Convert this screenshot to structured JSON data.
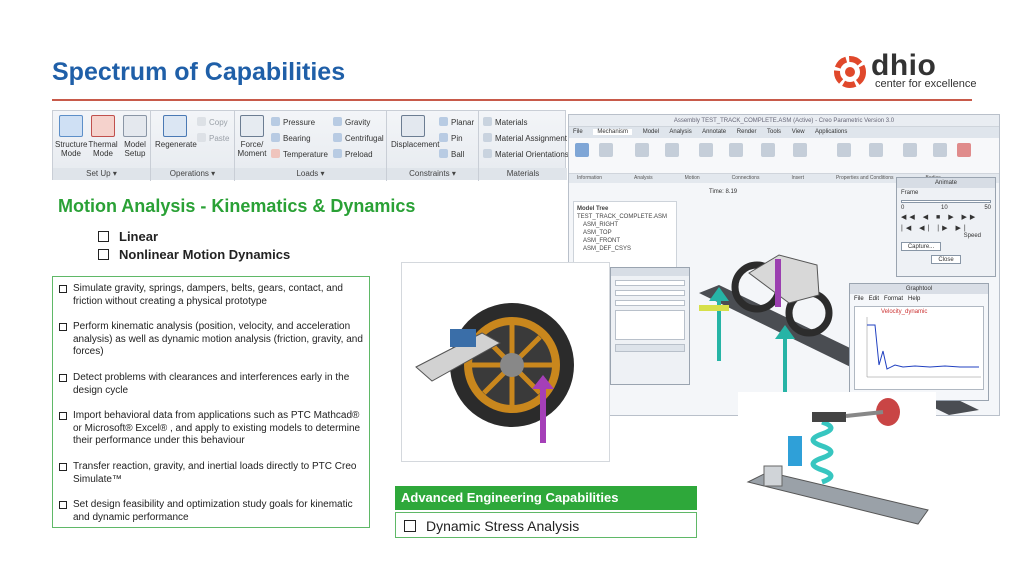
{
  "page": {
    "title": "Spectrum of Capabilities"
  },
  "logo": {
    "name": "dhio",
    "tagline": "center for excellence"
  },
  "ribbon": {
    "setup": {
      "label": "Set Up",
      "items": [
        "Structure Mode",
        "Thermal Mode",
        "Model Setup"
      ]
    },
    "operations": {
      "label": "Operations",
      "regenerate": "Regenerate",
      "copy": "Copy",
      "paste": "Paste"
    },
    "loads": {
      "label": "Loads",
      "force_moment": "Force/ Moment",
      "pressure": "Pressure",
      "bearing": "Bearing",
      "temperature": "Temperature",
      "gravity": "Gravity",
      "centrifugal": "Centrifugal",
      "preload": "Preload"
    },
    "constraints": {
      "label": "Constraints",
      "displacement": "Displacement",
      "planar": "Planar",
      "pin": "Pin",
      "ball": "Ball"
    },
    "materials": {
      "label": "Materials",
      "materials": "Materials",
      "assignment": "Material Assignment",
      "orientations": "Material Orientations"
    }
  },
  "cad_window": {
    "title": "Assembly TEST_TRACK_COMPLETE.ASM (Active) - Creo Parametric Version 3.0",
    "tabs": [
      "File",
      "Mechanism",
      "Model",
      "Analysis",
      "Annotate",
      "Render",
      "Tools",
      "View",
      "Applications"
    ],
    "active_tab": "Mechanism",
    "groups": [
      "Information",
      "Analysis",
      "Motion",
      "Connections",
      "Insert",
      "Properties and Conditions",
      "Bodies"
    ],
    "model_tree_title": "Model Tree",
    "model_tree_items": [
      "TEST_TRACK_COMPLETE.ASM",
      "ASM_RIGHT",
      "ASM_TOP",
      "ASM_FRONT",
      "ASM_DEF_CSYS"
    ],
    "time_label": "Time: 8.19",
    "animate_dialog": {
      "title": "Animate",
      "frame_label": "Frame",
      "scale": [
        "0",
        "10",
        "50"
      ],
      "speed_label": "Speed",
      "capture": "Capture...",
      "close": "Close"
    },
    "graph_window": {
      "title": "Graphtool",
      "chart_title": "Velocity_dynamic"
    }
  },
  "motion": {
    "heading": "Motion Analysis  - Kinematics & Dynamics",
    "bullets": [
      "Linear",
      "Nonlinear Motion Dynamics"
    ]
  },
  "features": [
    "Simulate gravity, springs, dampers, belts, gears, contact, and friction without creating a physical prototype",
    "Perform kinematic analysis (position, velocity, and acceleration analysis) as well as dynamic motion analysis (friction, gravity, and forces)",
    " Detect problems with clearances and interferences early in the design cycle",
    "Import behavioral data from applications such as PTC Mathcad® or Microsoft® Excel® , and apply to existing models to determine their performance under this behaviour",
    "Transfer reaction, gravity, and inertial loads directly to PTC Creo Simulate™",
    "Set design feasibility and optimization study goals for kinematic and dynamic performance"
  ],
  "advanced": {
    "heading": "Advanced Engineering Capabilities",
    "item": "Dynamic Stress Analysis"
  },
  "colors": {
    "title_blue": "#1f5fa8",
    "accent_green": "#2aa136",
    "rule_red": "#c85a4a",
    "logo_orange": "#e0482b"
  }
}
